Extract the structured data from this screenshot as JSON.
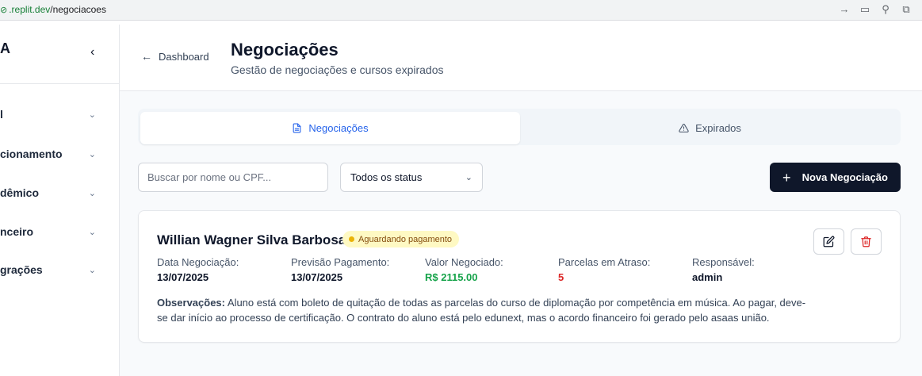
{
  "browser": {
    "url_host": ".replit.dev",
    "url_path": "/negociacoes"
  },
  "sidebar": {
    "brand": "A",
    "items": [
      {
        "label": "l"
      },
      {
        "label": "cionamento"
      },
      {
        "label": "dêmico"
      },
      {
        "label": "nceiro"
      },
      {
        "label": "grações"
      }
    ]
  },
  "header": {
    "back_label": "Dashboard",
    "title": "Negociações",
    "subtitle": "Gestão de negociações e cursos expirados"
  },
  "tabs": [
    {
      "label": "Negociações",
      "icon": "file-text-icon",
      "active": true
    },
    {
      "label": "Expirados",
      "icon": "alert-triangle-icon",
      "active": false
    }
  ],
  "filters": {
    "search_placeholder": "Buscar por nome ou CPF...",
    "search_value": "",
    "status_selected": "Todos os status"
  },
  "actions": {
    "new_label": "Nova Negociação"
  },
  "negotiation": {
    "name": "Willian Wagner Silva Barbosa",
    "status": "Aguardando pagamento",
    "fields": [
      {
        "label": "Data Negociação:",
        "value": "13/07/2025"
      },
      {
        "label": "Previsão Pagamento:",
        "value": "13/07/2025"
      },
      {
        "label": "Valor Negociado:",
        "value": "R$ 2115.00"
      },
      {
        "label": "Parcelas em Atraso:",
        "value": "5"
      },
      {
        "label": "Responsável:",
        "value": "admin"
      }
    ],
    "obs_label": "Observações:",
    "obs_text": " Aluno está com boleto de quitação de todas as parcelas do curso de diplomação por competência em música. Ao pagar, deve-se dar início ao processo de certificação. O contrato do aluno está pelo edunext, mas o acordo financeiro foi gerado pelo asaas união."
  },
  "colors": {
    "primary_button": "#0f172a",
    "active_tab": "#2563eb",
    "status_badge_bg": "#fef9c3",
    "amount_green": "#16a34a",
    "overdue_red": "#dc2626"
  }
}
